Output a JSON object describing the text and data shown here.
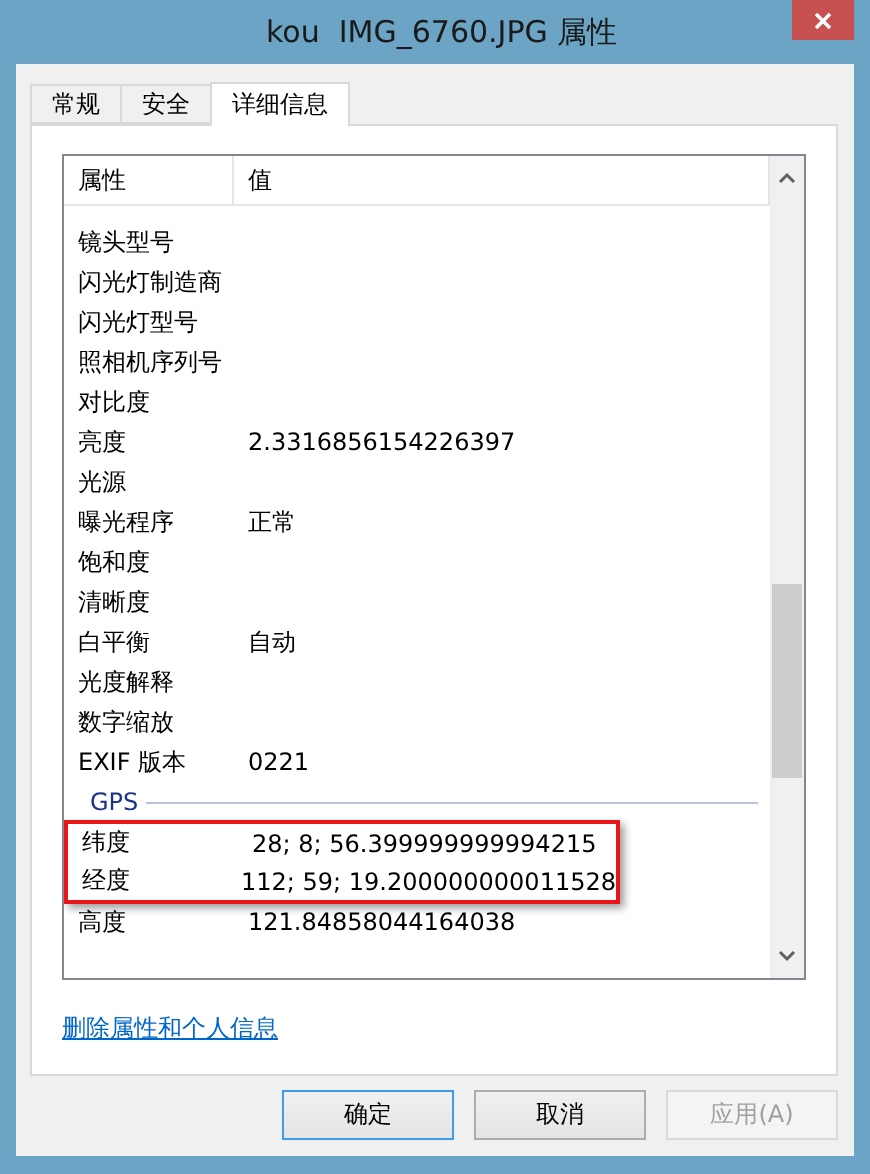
{
  "window": {
    "title": "kou  IMG_6760.JPG 属性"
  },
  "tabs": [
    {
      "label": "常规",
      "selected": false
    },
    {
      "label": "安全",
      "selected": false
    },
    {
      "label": "详细信息",
      "selected": true
    }
  ],
  "table": {
    "columns": [
      "属性",
      "值"
    ],
    "groups": [
      {
        "rows": [
          {
            "name": "镜头型号",
            "value": "",
            "highlighted": false
          },
          {
            "name": "闪光灯制造商",
            "value": "",
            "highlighted": false
          },
          {
            "name": "闪光灯型号",
            "value": "",
            "highlighted": false
          },
          {
            "name": "照相机序列号",
            "value": "",
            "highlighted": false
          },
          {
            "name": "对比度",
            "value": "",
            "highlighted": false
          },
          {
            "name": "亮度",
            "value": "2.3316856154226397",
            "highlighted": false
          },
          {
            "name": "光源",
            "value": "",
            "highlighted": false
          },
          {
            "name": "曝光程序",
            "value": "正常",
            "highlighted": false
          },
          {
            "name": "饱和度",
            "value": "",
            "highlighted": false
          },
          {
            "name": "清晰度",
            "value": "",
            "highlighted": false
          },
          {
            "name": "白平衡",
            "value": "自动",
            "highlighted": false
          },
          {
            "name": "光度解释",
            "value": "",
            "highlighted": false
          },
          {
            "name": "数字缩放",
            "value": "",
            "highlighted": false
          },
          {
            "name": "EXIF 版本",
            "value": "0221",
            "highlighted": false
          }
        ]
      },
      {
        "heading": "GPS",
        "rows": [
          {
            "name": "纬度",
            "value": "28; 8; 56.399999999994215",
            "highlighted": true
          },
          {
            "name": "经度",
            "value": "112; 59; 19.200000000011528",
            "highlighted": true
          },
          {
            "name": "高度",
            "value": "121.84858044164038",
            "highlighted": false
          }
        ]
      }
    ]
  },
  "link": "删除属性和个人信息",
  "buttons": [
    {
      "label": "确定",
      "default": true,
      "disabled": false
    },
    {
      "label": "取消",
      "default": false,
      "disabled": false
    },
    {
      "label": "应用(A)",
      "default": false,
      "disabled": true
    }
  ]
}
